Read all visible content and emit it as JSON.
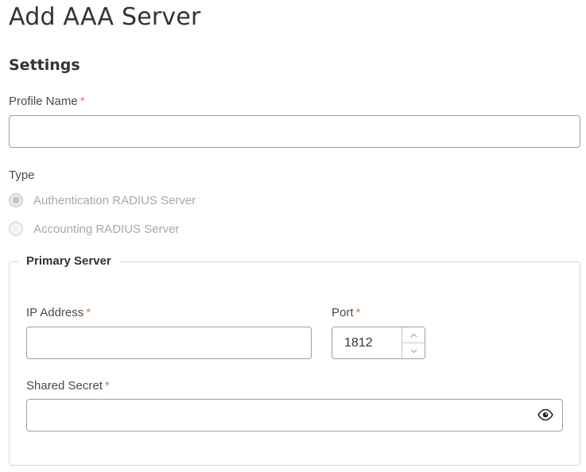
{
  "page": {
    "title": "Add AAA Server"
  },
  "settings": {
    "title": "Settings",
    "profile_name": {
      "label": "Profile Name",
      "required_mark": "*",
      "value": ""
    },
    "type": {
      "label": "Type",
      "options": [
        {
          "label": "Authentication RADIUS Server",
          "selected": true
        },
        {
          "label": "Accounting RADIUS Server",
          "selected": false
        }
      ]
    }
  },
  "primary_server": {
    "legend": "Primary Server",
    "ip_address": {
      "label": "IP Address",
      "required_mark": "*",
      "value": ""
    },
    "port": {
      "label": "Port",
      "required_mark": "*",
      "value": "1812"
    },
    "shared_secret": {
      "label": "Shared Secret",
      "required_mark": "*",
      "value": "",
      "icon": "eye-icon"
    }
  },
  "colors": {
    "required": "#e8793b",
    "border": "#9e9e9e",
    "disabled_text": "#a8a8a8"
  }
}
